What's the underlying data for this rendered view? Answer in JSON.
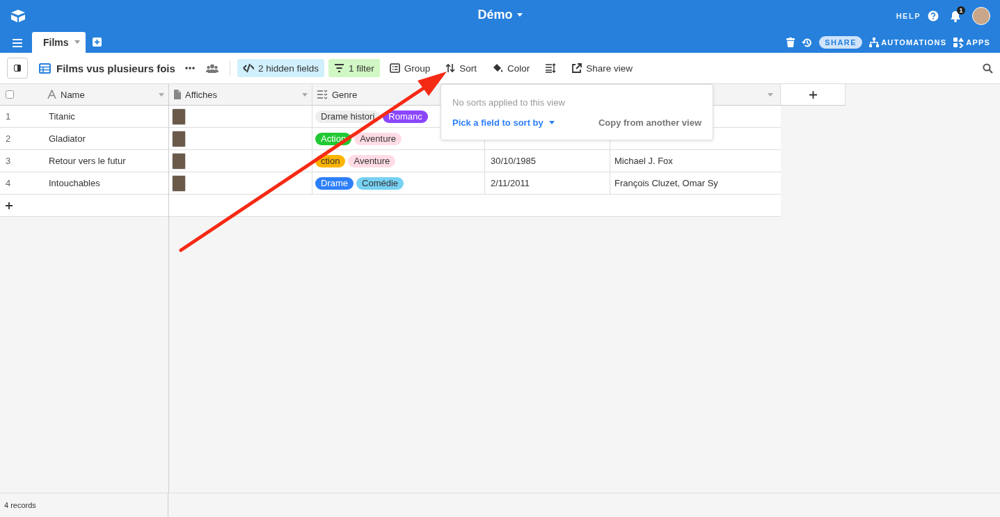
{
  "app": {
    "title": "Démo",
    "help": "HELP",
    "notifications": "1"
  },
  "tabs": [
    {
      "label": "Films",
      "selected": true
    }
  ],
  "header_actions": [
    {
      "kind": "share",
      "label": "SHARE"
    },
    {
      "kind": "automations",
      "label": "AUTOMATIONS"
    },
    {
      "kind": "apps",
      "label": "APPS"
    }
  ],
  "view": {
    "name": "Films vus plusieurs fois"
  },
  "toolbar": [
    {
      "kind": "hidden_fields",
      "label": "2 hidden fields"
    },
    {
      "kind": "filter",
      "label": "1 filter"
    },
    {
      "kind": "group",
      "label": "Group"
    },
    {
      "kind": "sort",
      "label": "Sort"
    },
    {
      "kind": "color",
      "label": "Color"
    },
    {
      "kind": "row_height"
    },
    {
      "kind": "share_view",
      "label": "Share view"
    }
  ],
  "table": {
    "select_all": {
      "checked": false
    },
    "columns": [
      {
        "kind": "text",
        "label": "Name"
      },
      {
        "kind": "attachment",
        "label": "Affiches"
      },
      {
        "kind": "multiselect",
        "label": "Genre"
      }
    ],
    "rows": [
      {
        "number": "1",
        "name": "Titanic",
        "genre": [
          {
            "label": "Drame histori",
            "color": "#eeeeee"
          },
          {
            "label": "Romanc",
            "color": "#8b46ff"
          }
        ]
      },
      {
        "number": "2",
        "name": "Gladiator",
        "genre": [
          {
            "label": "Action",
            "color": "#20c933"
          },
          {
            "label": "Aventure",
            "color": "#ffdce5"
          }
        ]
      },
      {
        "number": "3",
        "name": "Retour vers le futur",
        "genre": [
          {
            "label": "ction",
            "color": "#fcb400"
          },
          {
            "label": "Aventure",
            "color": "#ffdce5"
          }
        ],
        "column_4": "30/10/1985",
        "column_5": "Michael J. Fox"
      },
      {
        "number": "4",
        "name": "Intouchables",
        "genre": [
          {
            "label": "Drame",
            "color": "#2d7ff9"
          },
          {
            "label": "Comédie",
            "color": "#77d1f3"
          }
        ],
        "column_4": "2/11/2011",
        "column_5": "François Cluzet, Omar Sy"
      }
    ]
  },
  "sort_popover": {
    "message": "No sorts applied to this view",
    "pick_field": "Pick a field to sort by",
    "copy": "Copy from another view"
  },
  "status_bar": "4 records"
}
